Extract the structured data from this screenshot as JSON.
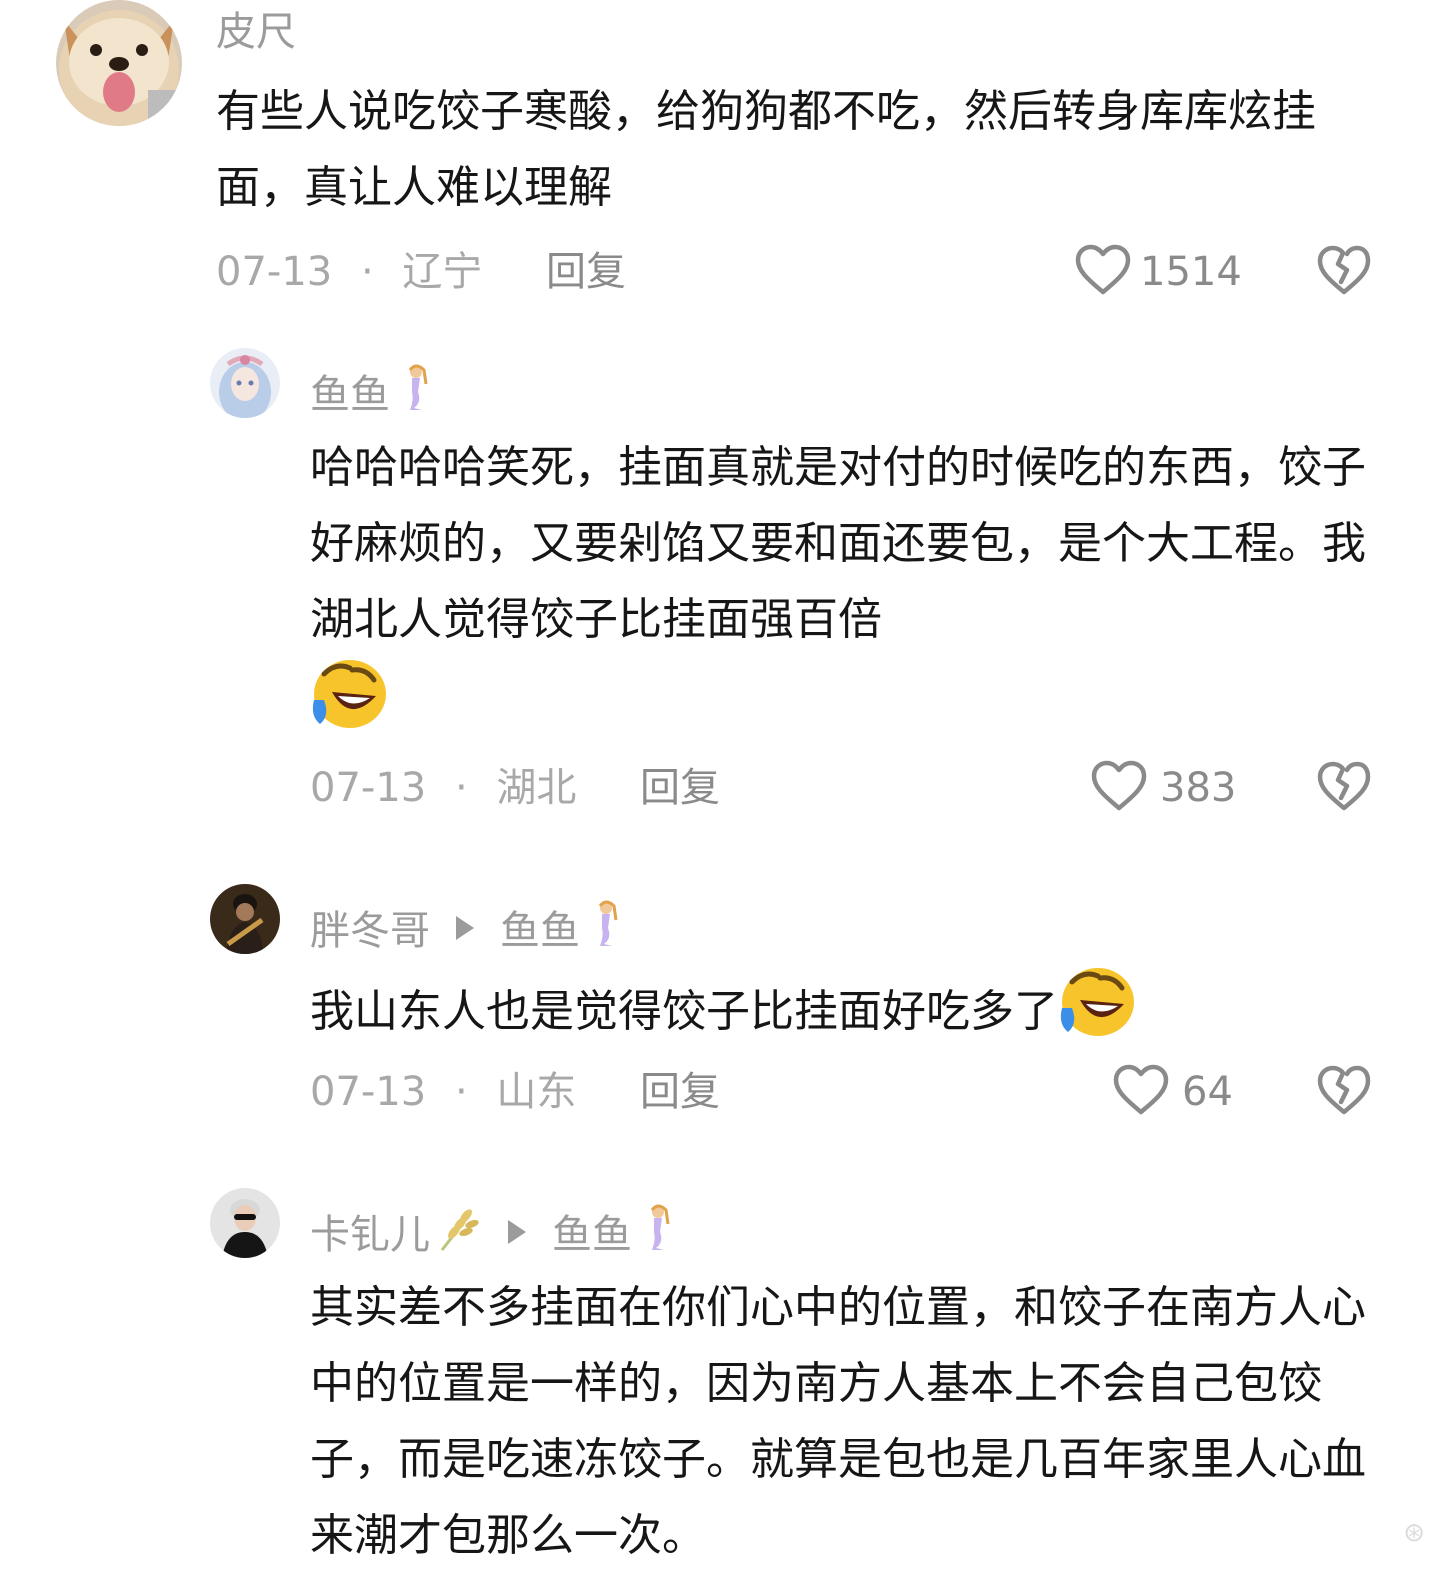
{
  "comments": [
    {
      "username": "皮尺",
      "text": "有些人说吃饺子寒酸，给狗狗都不吃，然后转身库库炫挂面，真让人难以理解",
      "date": "07-13",
      "location": "辽宁",
      "reply_label": "回复",
      "likes": "1514"
    },
    {
      "username": "鱼鱼",
      "text": "哈哈哈哈笑死，挂面真就是对付的时候吃的东西，饺子好麻烦的，又要剁馅又要和面还要包，是个大工程。我湖北人觉得饺子比挂面强百倍",
      "date": "07-13",
      "location": "湖北",
      "reply_label": "回复",
      "likes": "383"
    },
    {
      "username": "胖冬哥",
      "reply_to": "鱼鱼",
      "text": "我山东人也是觉得饺子比挂面好吃多了",
      "date": "07-13",
      "location": "山东",
      "reply_label": "回复",
      "likes": "64"
    },
    {
      "username": "卡钆儿",
      "reply_to": "鱼鱼",
      "text": "其实差不多挂面在你们心中的位置，和饺子在南方人心中的位置是一样的，因为南方人基本上不会自己包饺子，而是吃速冻饺子。就算是包也是几百年家里人心血来潮才包那么一次。"
    }
  ],
  "separator": "·",
  "icons": {
    "like": "heart-outline-icon",
    "dislike": "broken-heart-icon",
    "reply_arrow": "triangle-right-icon",
    "user_badge": "mermaid-icon",
    "laugh_emoji": "rolling-on-floor-laughing-emoji",
    "wheat": "wheat-icon"
  },
  "colors": {
    "text": "#161616",
    "muted": "#a8a8a8",
    "emoji_yellow": "#f7c52b"
  }
}
